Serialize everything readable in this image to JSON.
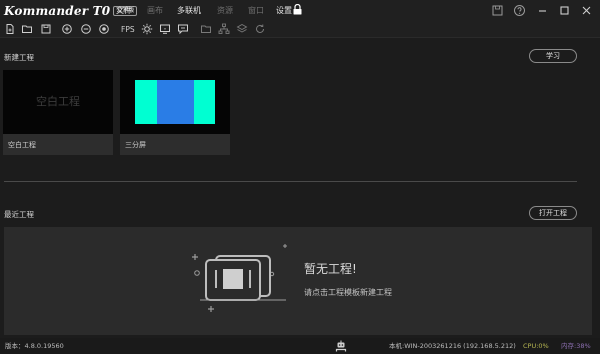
{
  "app": {
    "logo_text": "Kommander T0",
    "logo_badge": "公测版"
  },
  "menu": {
    "file": "文件",
    "canvas": "画布",
    "multi_link": "多联机",
    "resources": "资源",
    "window": "窗口",
    "settings": "设置"
  },
  "toolbar": {
    "fps_label": "FPS"
  },
  "new_project": {
    "title": "新建工程",
    "learn_button": "学习",
    "templates": [
      {
        "label": "空白工程",
        "thumb_text": "空白工程"
      },
      {
        "label": "三分屏"
      }
    ]
  },
  "three_split_colors": {
    "left": "#00ffd2",
    "center": "#2a7de6",
    "right": "#00ffd2"
  },
  "recent": {
    "title": "最近工程",
    "open_button": "打开工程",
    "empty_title": "暂无工程!",
    "empty_subtitle": "请点击工程模板新建工程"
  },
  "status": {
    "version": "版本：4.8.0.19560",
    "host": "本机:WIN-2003261216 (192.168.5.212)",
    "cpu": "CPU:0%",
    "memory": "内存:38%"
  },
  "colors": {
    "background": "#1c1c1c",
    "panel": "#2b2b2b",
    "cpu": "#b6b651",
    "memory": "#8c6fb0"
  },
  "icons": [
    "new-file-icon",
    "open-folder-icon",
    "save-icon",
    "zoom-in-icon",
    "zoom-out-icon",
    "fit-icon",
    "brightness-icon",
    "screen-icon",
    "message-icon",
    "folder-icon",
    "network-icon",
    "layers-icon",
    "refresh-icon",
    "lock-icon",
    "save-window-icon",
    "help-icon",
    "minimize-icon",
    "maximize-icon",
    "close-icon",
    "robot-icon"
  ]
}
